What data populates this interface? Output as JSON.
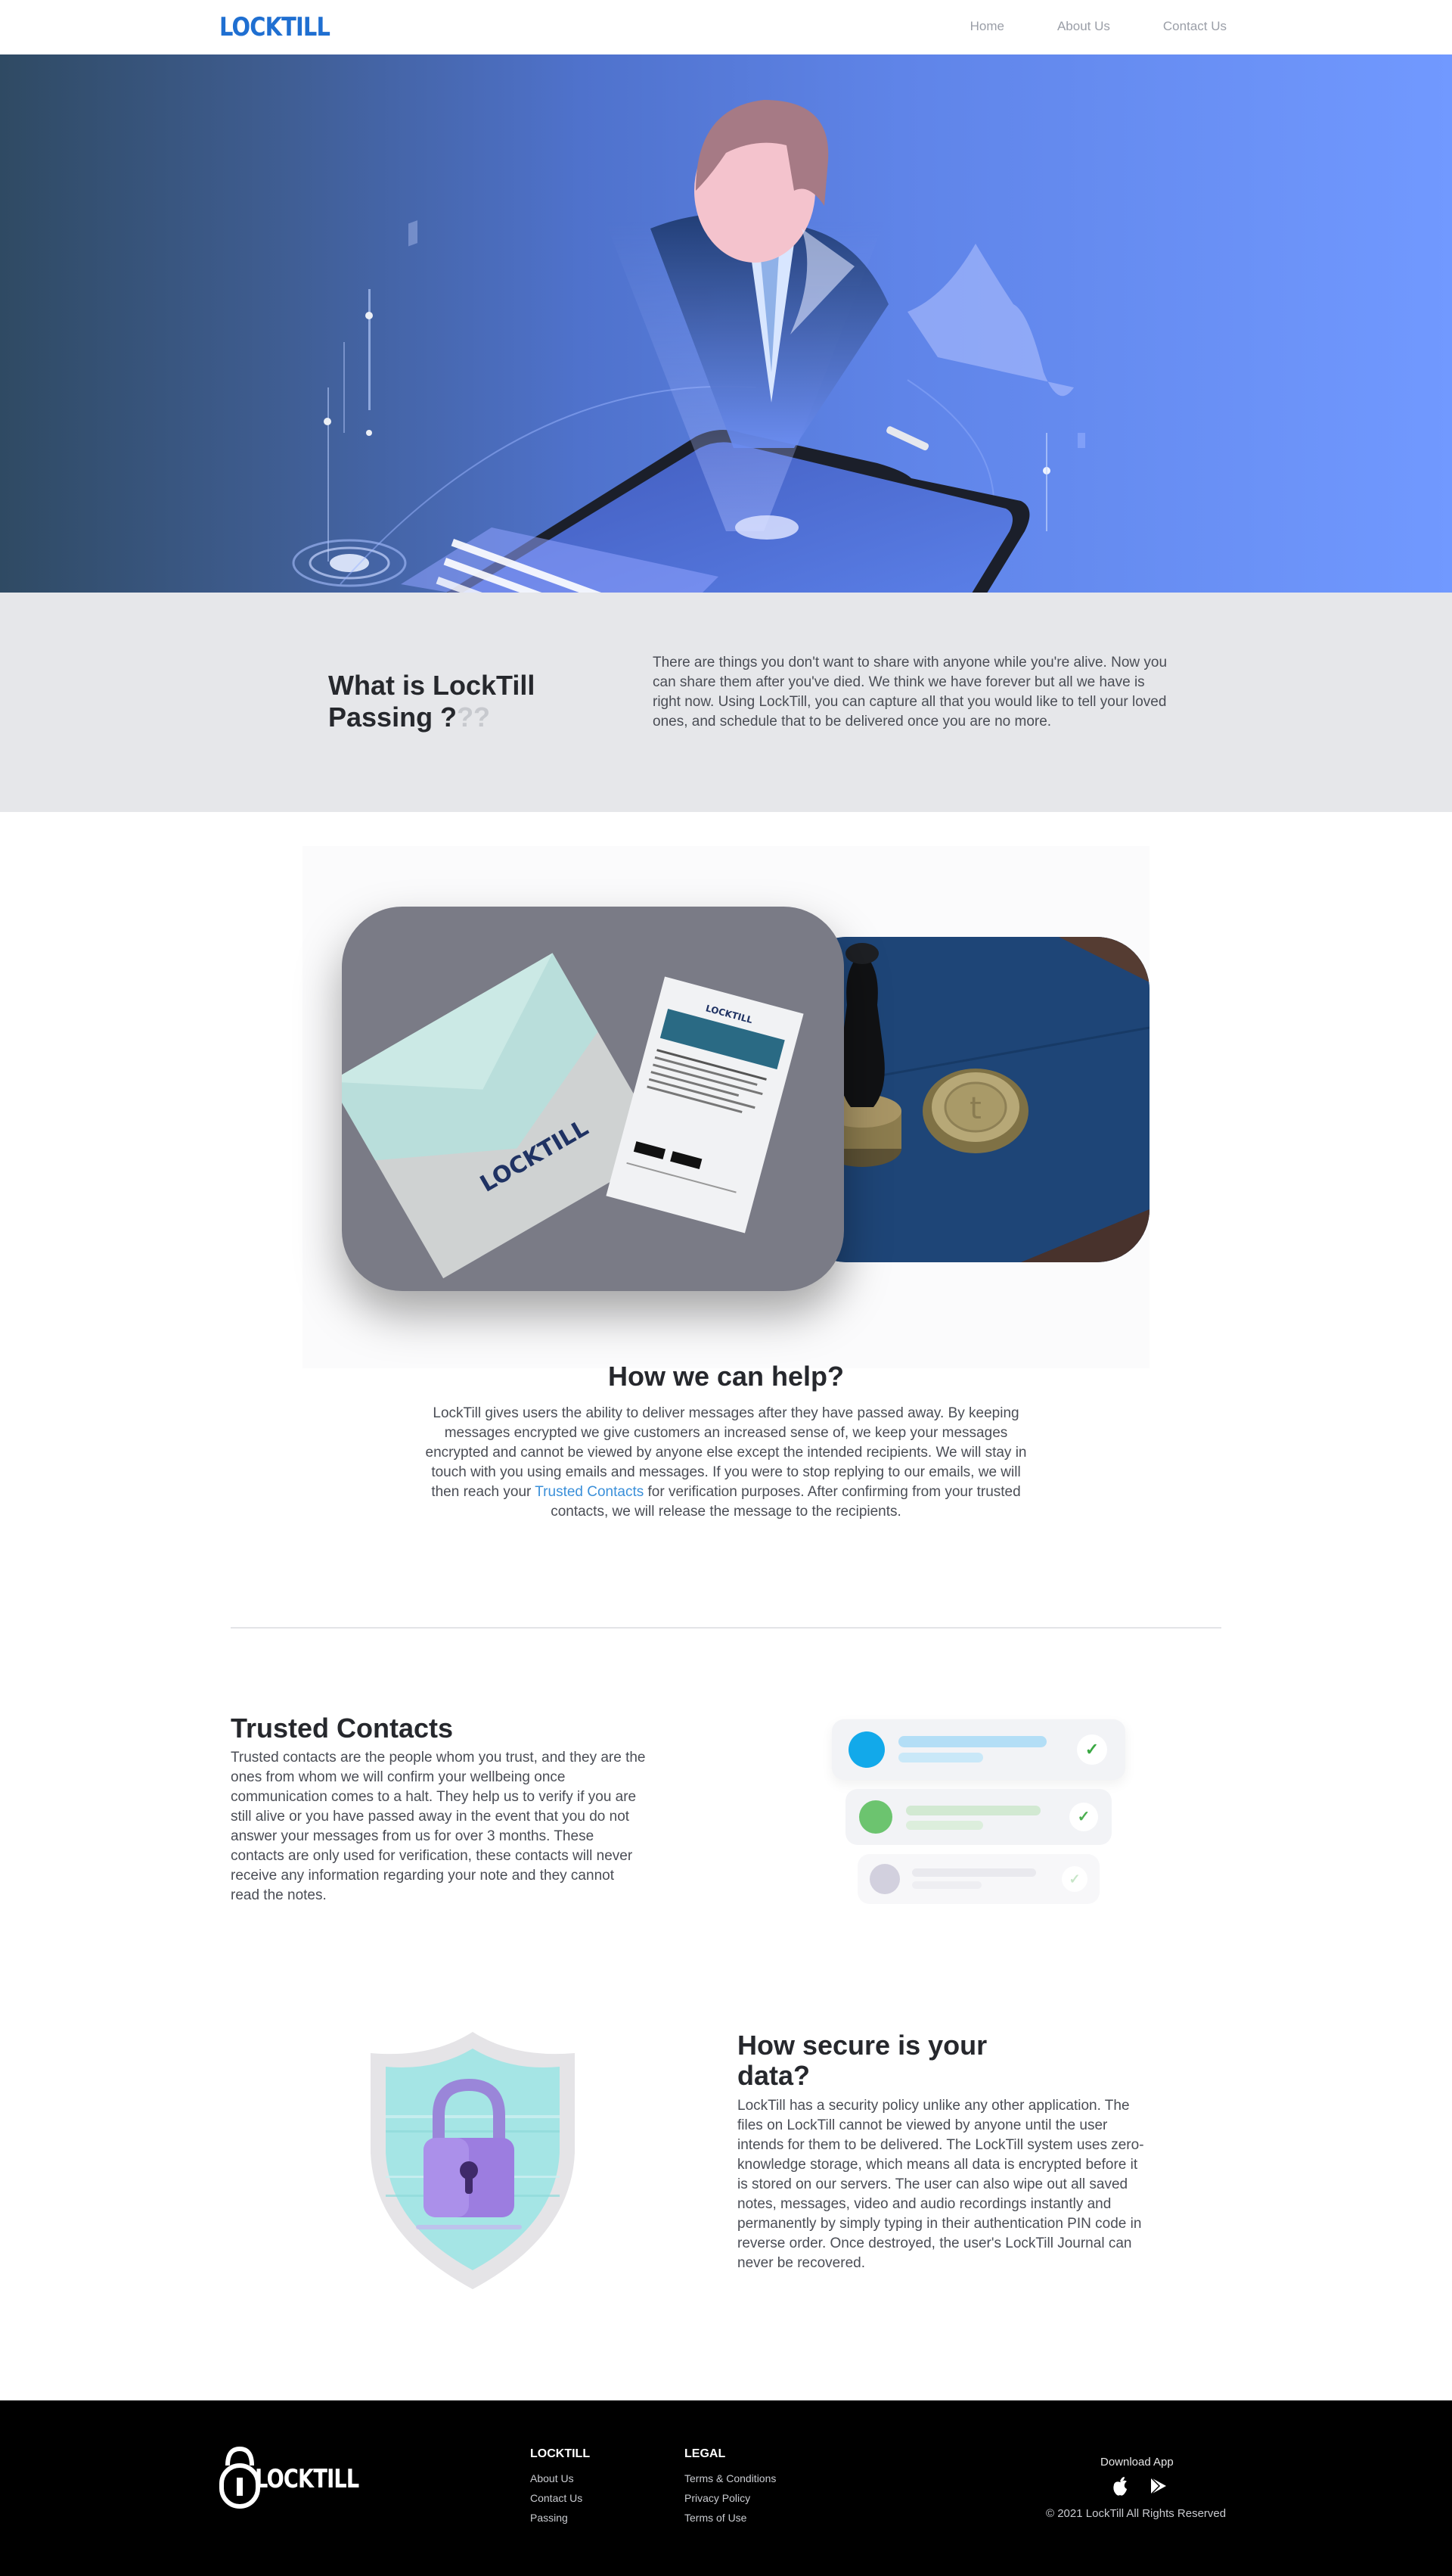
{
  "nav": {
    "logo": "LOCKTILL",
    "links": [
      "Home",
      "About Us",
      "Contact Us"
    ]
  },
  "what_is": {
    "title_main": "What is LockTill Passing ?",
    "title_fade": "??",
    "body": "There are things you don't want to share with anyone while you're alive. Now you can share them after you've died. We think we have forever but all we have is right now. Using LockTill, you can capture all that you would like to tell your loved ones, and schedule that to be delivered once you are no more."
  },
  "collage": {
    "envelope_logo": "LOCKTILL",
    "letter_logo": "LOCKTILL"
  },
  "help": {
    "title": "How we can help?",
    "body_before": "LockTill gives users the ability to deliver messages after they have passed away. By keeping messages encrypted we give customers an increased sense of, we keep your messages encrypted and cannot be viewed by anyone else except the intended recipients. We will stay in touch with you using emails and messages. If you were to stop replying to our emails, we will then reach your ",
    "link": "Trusted Contacts",
    "body_after": " for verification purposes. After confirming from your trusted contacts, we will release the message to the recipients."
  },
  "trusted": {
    "title": "Trusted Contacts",
    "body": "Trusted contacts are the people whom you trust, and they are the ones from whom we will confirm your wellbeing once communication comes to a halt. They help us to verify if you are still alive or you have passed away in the event that you do not answer your messages from us for over 3 months. These contacts are only used for verification, these contacts will never receive any information regarding your note and they cannot read the notes.",
    "contact_colors": [
      "#12a9ea",
      "#6cc46f",
      "#d2d0de"
    ],
    "check_icon": "check-icon"
  },
  "secure": {
    "title": "How secure is your data?",
    "body": "LockTill has a security policy unlike any other application. The files on LockTill cannot be viewed by anyone until the user intends for them to be delivered. The LockTill system uses zero-knowledge storage, which means all data is encrypted before it is stored on our servers. The user can also wipe out all saved notes, messages, video and audio recordings instantly and permanently by simply typing in their authentication PIN code in reverse order. Once destroyed, the user's LockTill Journal can never be recovered."
  },
  "footer": {
    "logo": "LOCKTILL",
    "col1": {
      "heading": "LOCKTILL",
      "links": [
        "About Us",
        "Contact Us",
        "Passing"
      ]
    },
    "col2": {
      "heading": "LEGAL",
      "links": [
        "Terms & Conditions",
        "Privacy Policy",
        "Terms of Use"
      ]
    },
    "download_label": "Download App",
    "store_icons": [
      "apple-icon",
      "google-play-icon"
    ],
    "copyright": "© 2021 LockTill All Rights Reserved"
  },
  "colors": {
    "brand": "#1f6fd1",
    "link": "#3a8fd9",
    "hero_start": "#2f4a63",
    "hero_end": "#7199ff"
  }
}
